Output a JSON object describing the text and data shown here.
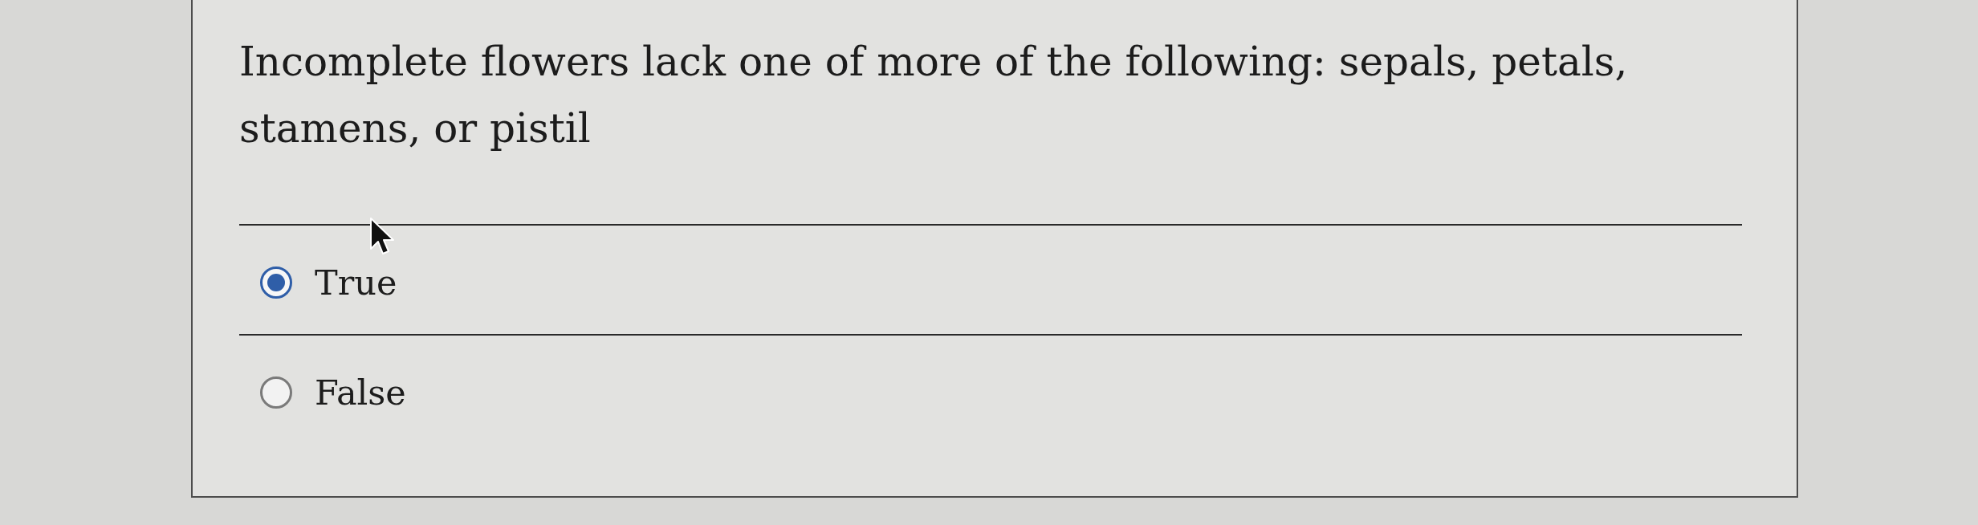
{
  "question": {
    "text": "Incomplete flowers lack one of more of the following: sepals, petals, stamens, or pistil"
  },
  "options": [
    {
      "label": "True",
      "selected": true
    },
    {
      "label": "False",
      "selected": false
    }
  ]
}
